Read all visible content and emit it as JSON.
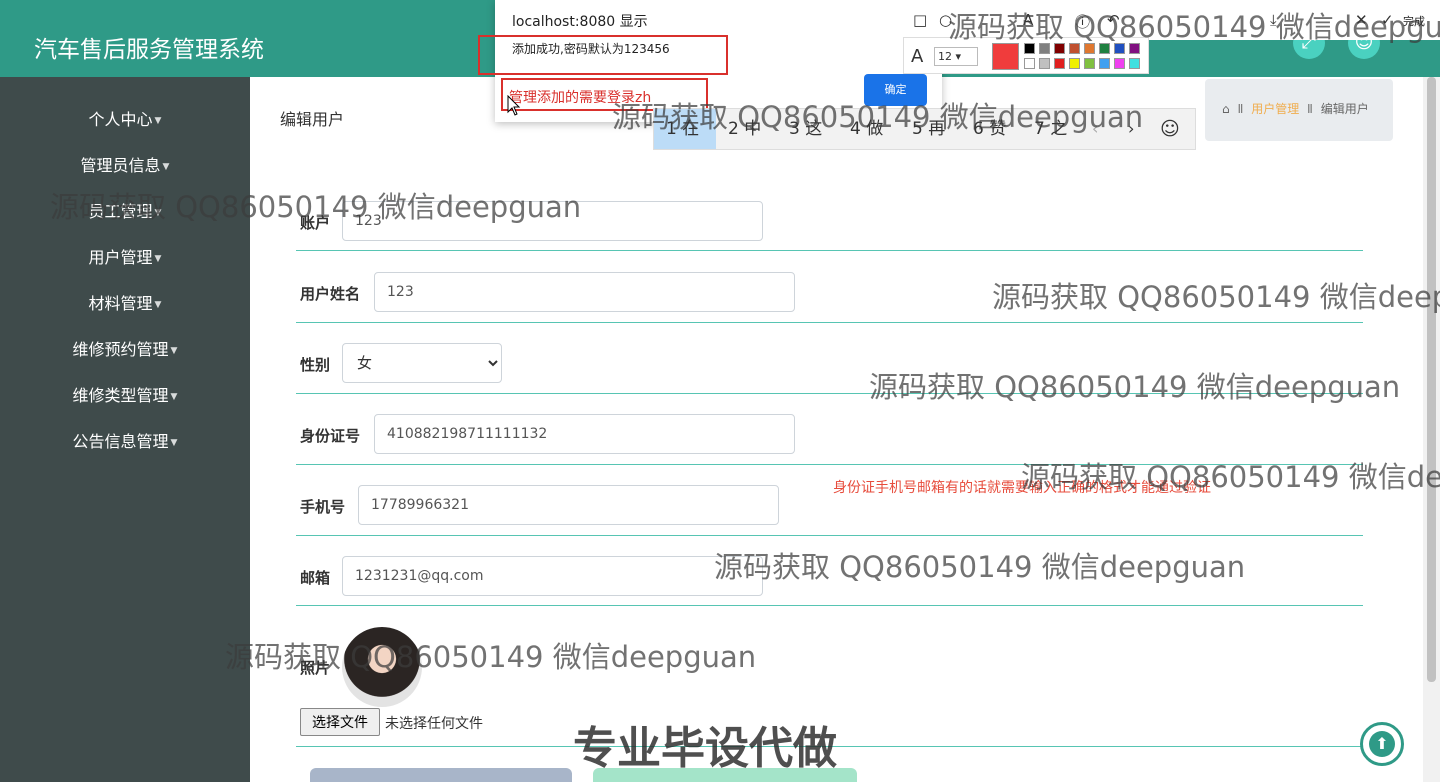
{
  "header": {
    "app_title": "汽车售后服务管理系统",
    "fullscreen_icon": "expand-icon",
    "user_icon": "user-icon"
  },
  "sidebar": {
    "items": [
      {
        "label": "个人中心"
      },
      {
        "label": "管理员信息"
      },
      {
        "label": "员工管理"
      },
      {
        "label": "用户管理"
      },
      {
        "label": "材料管理"
      },
      {
        "label": "维修预约管理"
      },
      {
        "label": "维修类型管理"
      },
      {
        "label": "公告信息管理"
      }
    ]
  },
  "main": {
    "page_title": "编辑用户",
    "breadcrumb": {
      "sep": "Ⅱ",
      "section": "用户管理",
      "current": "编辑用户"
    },
    "form": {
      "account_label": "账户",
      "account_value": "123",
      "name_label": "用户姓名",
      "name_value": "123",
      "gender_label": "性别",
      "gender_value": "女",
      "idcard_label": "身份证号",
      "idcard_value": "410882198711111132",
      "phone_label": "手机号",
      "phone_value": "17789966321",
      "email_label": "邮箱",
      "email_value": "1231231@qq.com",
      "photo_label": "照片",
      "file_button": "选择文件",
      "file_status": "未选择任何文件"
    },
    "hint": "身份证手机号邮箱有的话就需要输入正确的格式才能通过验证"
  },
  "alert": {
    "title": "localhost:8080 显示",
    "message": "添加成功,密码默认为123456",
    "ok_label": "确定"
  },
  "annotation_note": "管理添加的需要登录zh",
  "ime": {
    "candidates": [
      "1 在",
      "2 中",
      "3 这",
      "4 做",
      "5 再",
      "6 赞",
      "7 之"
    ],
    "prev": "‹",
    "next": "›",
    "emoji": "☺"
  },
  "snip_toolbar": {
    "done_label": "完成",
    "font_size": "12",
    "selected_color": "#f03c3c",
    "palette": [
      "#000000",
      "#808080",
      "#800000",
      "#c05030",
      "#e07830",
      "#208040",
      "#2050c0",
      "#801080",
      "#20a0a0",
      "#ffffff",
      "#c0c0c0",
      "#e02020",
      "#f0f000",
      "#80c040",
      "#40a0f0",
      "#f040f0",
      "#40e0e0"
    ]
  },
  "watermarks": {
    "line": "源码获取 QQ86050149 微信deepguan",
    "line_cut_1": "源码获取 QQ86050149 微信deepgu",
    "line_cut_2": "源码获取 QQ86050149 微信deep",
    "line_cut_3": "源码获取 QQ86050149 微信de",
    "big": "专业毕设代做"
  },
  "colors": {
    "header": "#2f9a87",
    "sidebar": "#3f4b4b",
    "accent": "#57c5b3",
    "error": "#e74c3c"
  }
}
